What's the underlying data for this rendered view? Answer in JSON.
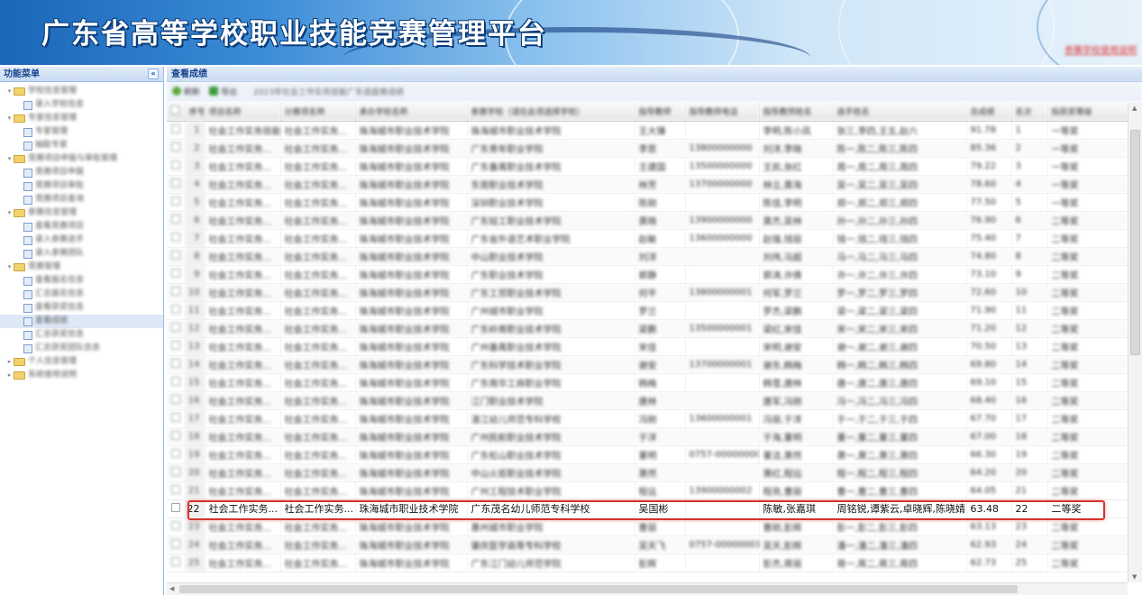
{
  "app": {
    "title": "广东省高等学校职业技能竞赛管理平台",
    "help_link": "参赛学校使用说明"
  },
  "sidebar": {
    "title": "功能菜单",
    "collapse_glyph": "«",
    "nodes": [
      {
        "level": 0,
        "type": "folder",
        "label": "学校信息管理"
      },
      {
        "level": 1,
        "type": "doc",
        "label": "录入学校信息"
      },
      {
        "level": 0,
        "type": "folder",
        "label": "专家信息管理"
      },
      {
        "level": 1,
        "type": "doc",
        "label": "专家管理"
      },
      {
        "level": 1,
        "type": "doc",
        "label": "抽取专家"
      },
      {
        "level": 0,
        "type": "folder",
        "label": "竞赛项目申报与审批管理"
      },
      {
        "level": 1,
        "type": "doc",
        "label": "竞赛项目申报"
      },
      {
        "level": 1,
        "type": "doc",
        "label": "竞赛项目审批"
      },
      {
        "level": 1,
        "type": "doc",
        "label": "竞赛项目查询"
      },
      {
        "level": 0,
        "type": "folder",
        "label": "参赛信息管理"
      },
      {
        "level": 1,
        "type": "doc",
        "label": "查看竞赛项目"
      },
      {
        "level": 1,
        "type": "doc",
        "label": "录入参赛选手"
      },
      {
        "level": 1,
        "type": "doc",
        "label": "录入参赛团队"
      },
      {
        "level": 0,
        "type": "folder",
        "label": "竞赛管理"
      },
      {
        "level": 1,
        "type": "doc",
        "label": "查看报名信息"
      },
      {
        "level": 1,
        "type": "doc",
        "label": "汇总报名信息"
      },
      {
        "level": 1,
        "type": "doc",
        "label": "查看获奖信息"
      },
      {
        "level": 1,
        "type": "doc",
        "label": "查看成绩",
        "selected": true
      },
      {
        "level": 1,
        "type": "doc",
        "label": "汇总获奖信息"
      },
      {
        "level": 1,
        "type": "doc",
        "label": "汇总获奖团队信息"
      },
      {
        "level": 0,
        "type": "folder",
        "label": "个人信息管理"
      },
      {
        "level": 0,
        "type": "folder",
        "label": "系统使用说明"
      }
    ]
  },
  "main": {
    "panel_title": "查看成绩",
    "toolbar": {
      "refresh_label": "刷新",
      "export_label": "导出",
      "info_text": "2023年社会工作实务技能广东选拔赛成绩"
    },
    "columns": [
      "序号",
      "项目名称",
      "分赛项名称",
      "承办学校名称",
      "参赛学校（请在此项选择学校）",
      "指导教师",
      "指导教师电话",
      "指导教师姓名",
      "选手姓名",
      "总成绩",
      "名次",
      "拟获奖等级"
    ],
    "rows": [
      {
        "no": "1",
        "cells": [
          "社会工作实务技能",
          "社会工作实务...",
          "珠海城市职业技术学院",
          "珠海城市职业技术学院",
          "王大锤",
          "",
          "李明,陈小凤",
          "张三,李四,王五,赵六",
          "91.78",
          "1",
          "一等奖"
        ]
      },
      {
        "no": "2",
        "cells": [
          "社会工作实务...",
          "社会工作实务...",
          "珠海城市职业技术学院",
          "广东青年职业学院",
          "李思",
          "13800000000",
          "刘洋,李晓",
          "陈一,陈二,陈三,陈四",
          "85.36",
          "2",
          "一等奖"
        ]
      },
      {
        "no": "3",
        "cells": [
          "社会工作实务...",
          "社会工作实务...",
          "珠海城市职业技术学院",
          "广东番禺职业技术学院",
          "王建国",
          "13500000000",
          "王凯,张红",
          "周一,周二,周三,周四",
          "79.22",
          "3",
          "一等奖"
        ]
      },
      {
        "no": "4",
        "cells": [
          "社会工作实务...",
          "社会工作实务...",
          "珠海城市职业技术学院",
          "东莞职业技术学院",
          "林芳",
          "13700000000",
          "林立,黄海",
          "吴一,吴二,吴三,吴四",
          "78.60",
          "4",
          "一等奖"
        ]
      },
      {
        "no": "5",
        "cells": [
          "社会工作实务...",
          "社会工作实务...",
          "珠海城市职业技术学院",
          "深圳职业技术学院",
          "陈刚",
          "",
          "陈佳,李明",
          "郑一,郑二,郑三,郑四",
          "77.50",
          "5",
          "一等奖"
        ]
      },
      {
        "no": "6",
        "cells": [
          "社会工作实务...",
          "社会工作实务...",
          "珠海城市职业技术学院",
          "广东轻工职业技术学院",
          "黄晓",
          "13900000000",
          "黄杰,吴林",
          "孙一,孙二,孙三,孙四",
          "76.90",
          "6",
          "二等奖"
        ]
      },
      {
        "no": "7",
        "cells": [
          "社会工作实务...",
          "社会工作实务...",
          "珠海城市职业技术学院",
          "广东省外语艺术职业学院",
          "赵敏",
          "13600000000",
          "赵强,钱丽",
          "钱一,钱二,钱三,钱四",
          "75.40",
          "7",
          "二等奖"
        ]
      },
      {
        "no": "8",
        "cells": [
          "社会工作实务...",
          "社会工作实务...",
          "珠海城市职业技术学院",
          "中山职业技术学院",
          "刘洋",
          "",
          "刘伟,马超",
          "马一,马二,马三,马四",
          "74.80",
          "8",
          "二等奖"
        ]
      },
      {
        "no": "9",
        "cells": [
          "社会工作实务...",
          "社会工作实务...",
          "珠海城市职业技术学院",
          "广东职业技术学院",
          "郭静",
          "",
          "郭涛,许倩",
          "许一,许二,许三,许四",
          "73.10",
          "9",
          "二等奖"
        ]
      },
      {
        "no": "10",
        "cells": [
          "社会工作实务...",
          "社会工作实务...",
          "珠海城市职业技术学院",
          "广东工贸职业技术学院",
          "何平",
          "13800000001",
          "何军,罗兰",
          "罗一,罗二,罗三,罗四",
          "72.60",
          "10",
          "二等奖"
        ]
      },
      {
        "no": "11",
        "cells": [
          "社会工作实务...",
          "社会工作实务...",
          "珠海城市职业技术学院",
          "广州城市职业学院",
          "罗兰",
          "",
          "罗杰,梁鹏",
          "梁一,梁二,梁三,梁四",
          "71.90",
          "11",
          "二等奖"
        ]
      },
      {
        "no": "12",
        "cells": [
          "社会工作实务...",
          "社会工作实务...",
          "珠海城市职业技术学院",
          "广东岭南职业技术学院",
          "梁鹏",
          "13500000001",
          "梁红,宋佳",
          "宋一,宋二,宋三,宋四",
          "71.20",
          "12",
          "二等奖"
        ]
      },
      {
        "no": "13",
        "cells": [
          "社会工作实务...",
          "社会工作实务...",
          "珠海城市职业技术学院",
          "广州番禺职业技术学院",
          "宋佳",
          "",
          "宋明,谢安",
          "谢一,谢二,谢三,谢四",
          "70.50",
          "13",
          "二等奖"
        ]
      },
      {
        "no": "14",
        "cells": [
          "社会工作实务...",
          "社会工作实务...",
          "珠海城市职业技术学院",
          "广东科学技术职业学院",
          "谢安",
          "13700000001",
          "谢东,韩梅",
          "韩一,韩二,韩三,韩四",
          "69.80",
          "14",
          "二等奖"
        ]
      },
      {
        "no": "15",
        "cells": [
          "社会工作实务...",
          "社会工作实务...",
          "珠海城市职业技术学院",
          "广东南华工商职业学院",
          "韩梅",
          "",
          "韩雪,唐林",
          "唐一,唐二,唐三,唐四",
          "69.10",
          "15",
          "二等奖"
        ]
      },
      {
        "no": "16",
        "cells": [
          "社会工作实务...",
          "社会工作实务...",
          "珠海城市职业技术学院",
          "江门职业技术学院",
          "唐林",
          "",
          "唐军,冯刚",
          "冯一,冯二,冯三,冯四",
          "68.40",
          "16",
          "二等奖"
        ]
      },
      {
        "no": "17",
        "cells": [
          "社会工作实务...",
          "社会工作实务...",
          "珠海城市职业技术学院",
          "湛江幼儿师范专科学校",
          "冯刚",
          "13600000001",
          "冯丽,于洋",
          "于一,于二,于三,于四",
          "67.70",
          "17",
          "二等奖"
        ]
      },
      {
        "no": "18",
        "cells": [
          "社会工作实务...",
          "社会工作实务...",
          "珠海城市职业技术学院",
          "广州民航职业技术学院",
          "于洋",
          "",
          "于海,董明",
          "董一,董二,董三,董四",
          "67.00",
          "18",
          "二等奖"
        ]
      },
      {
        "no": "19",
        "cells": [
          "社会工作实务...",
          "社会工作实务...",
          "珠海城市职业技术学院",
          "广东松山职业技术学院",
          "董明",
          "0757-00000000",
          "董洁,萧然",
          "萧一,萧二,萧三,萧四",
          "66.30",
          "19",
          "二等奖"
        ]
      },
      {
        "no": "20",
        "cells": [
          "社会工作实务...",
          "社会工作实务...",
          "珠海城市职业技术学院",
          "中山火炬职业技术学院",
          "萧然",
          "",
          "萧红,程远",
          "程一,程二,程三,程四",
          "64.20",
          "20",
          "二等奖"
        ]
      },
      {
        "no": "21",
        "cells": [
          "社会工作实务...",
          "社会工作实务...",
          "珠海城市职业技术学院",
          "广州工程技术职业学院",
          "程远",
          "13900000002",
          "程亮,曹丽",
          "曹一,曹二,曹三,曹四",
          "64.05",
          "21",
          "二等奖"
        ]
      },
      {
        "no": "22",
        "highlight": true,
        "cells": [
          "社会工作实务...",
          "社会工作实务...",
          "珠海城市职业技术学院",
          "广东茂名幼儿师范专科学校",
          "吴国彬",
          "",
          "陈敏,张嘉琪",
          "周铭锐,谭紫云,卓晓辉,陈晓婧",
          "63.48",
          "22",
          "二等奖"
        ]
      },
      {
        "no": "23",
        "cells": [
          "社会工作实务...",
          "社会工作实务...",
          "珠海城市职业技术学院",
          "惠州城市职业学院",
          "曹丽",
          "",
          "曹刚,彭辉",
          "彭一,彭二,彭三,彭四",
          "63.13",
          "23",
          "二等奖"
        ]
      },
      {
        "no": "24",
        "cells": [
          "社会工作实务...",
          "社会工作实务...",
          "珠海城市职业技术学院",
          "肇庆医学高等专科学校",
          "吴天飞",
          "0757-00000001",
          "吴天,彭辉",
          "潘一,潘二,潘三,潘四",
          "62.93",
          "24",
          "二等奖"
        ]
      },
      {
        "no": "25",
        "cells": [
          "社会工作实务...",
          "社会工作实务...",
          "珠海城市职业技术学院",
          "广东江门幼儿师范学院",
          "彭辉",
          "",
          "彭杰,蒋丽",
          "蒋一,蒋二,蒋三,蒋四",
          "62.73",
          "25",
          "二等奖"
        ]
      }
    ]
  }
}
